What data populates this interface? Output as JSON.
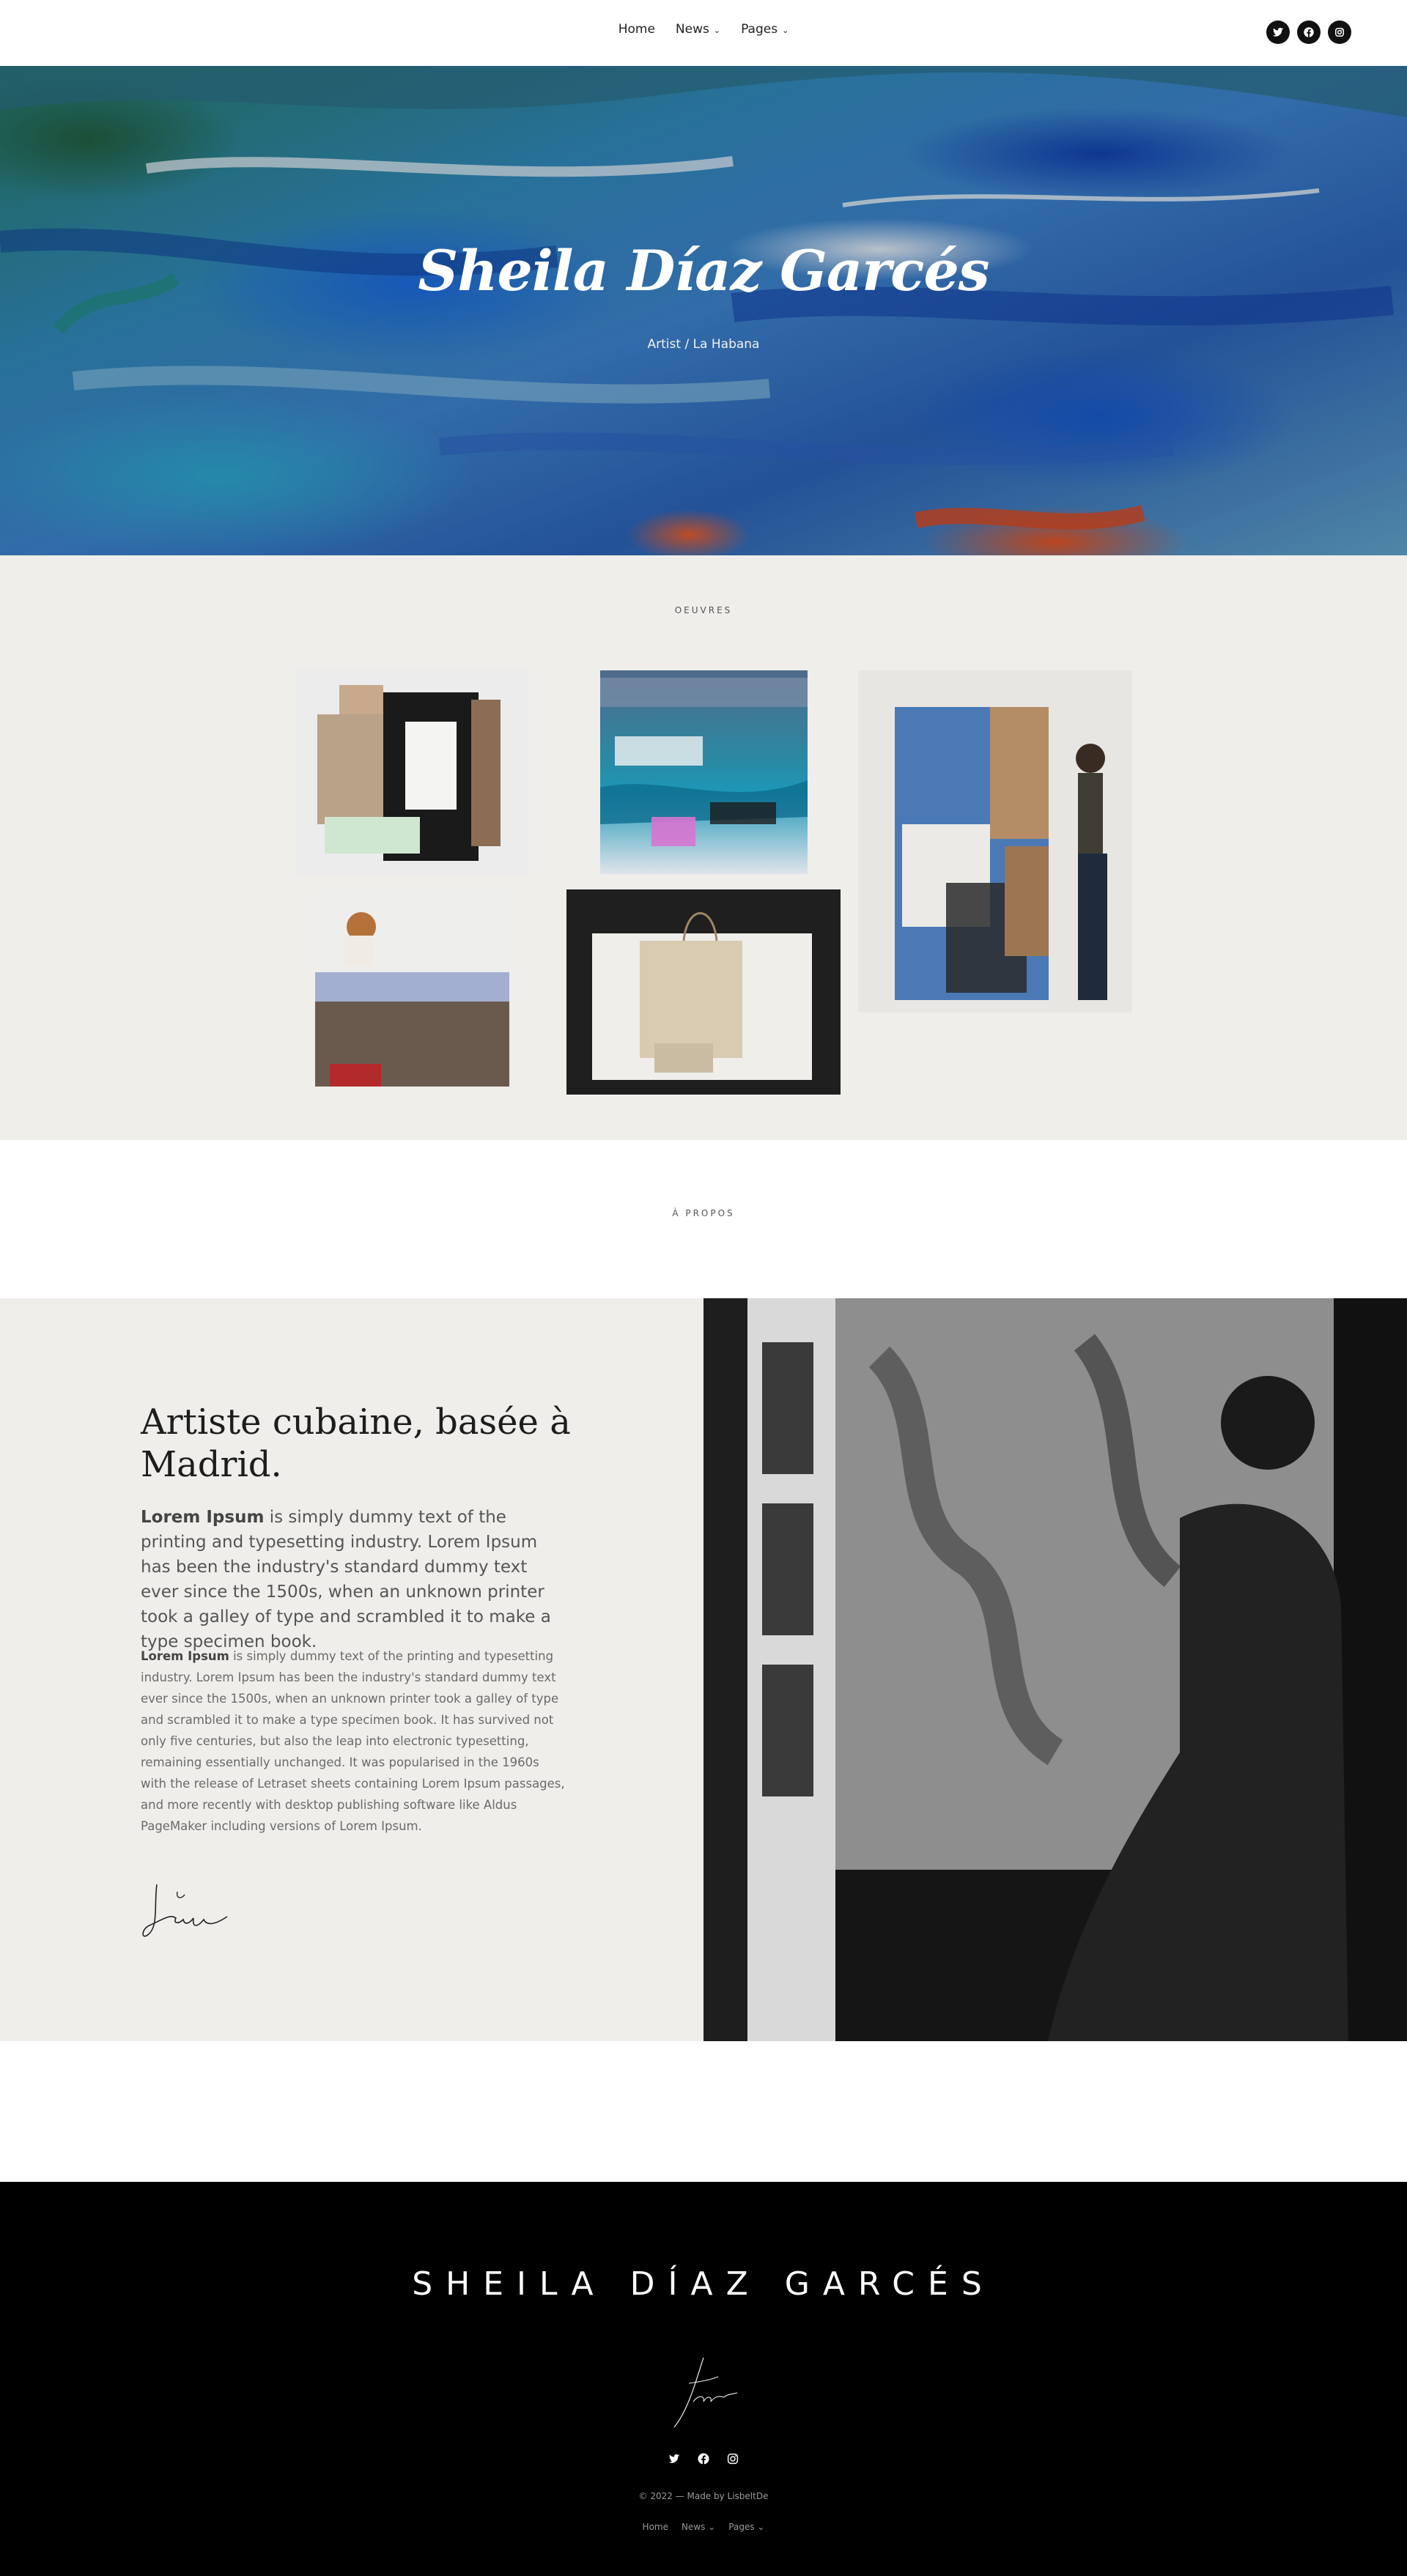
{
  "nav": {
    "items": [
      {
        "label": "Home",
        "has_dropdown": false
      },
      {
        "label": "News",
        "has_dropdown": true
      },
      {
        "label": "Pages",
        "has_dropdown": true
      }
    ],
    "socials": [
      "twitter-icon",
      "facebook-icon",
      "instagram-icon"
    ]
  },
  "hero": {
    "title": "Sheila Díaz Garcés",
    "subtitle": "Artist / La Habana"
  },
  "oeuvres": {
    "label": "OEUVRES"
  },
  "apropos": {
    "label": "À PROPOS",
    "heading": "Artiste cubaine, basée à Madrid.",
    "lead_bold": "Lorem Ipsum",
    "lead_text": " is simply dummy text of the printing and typesetting industry. Lorem Ipsum has been the industry's standard dummy text ever since the 1500s, when an unknown printer took a galley of type and scrambled it to make a type specimen book.",
    "body_bold": "Lorem Ipsum",
    "body_text": " is simply dummy text of the printing and typesetting industry. Lorem Ipsum has been the industry's standard dummy text ever since the 1500s, when an unknown printer took a galley of type and scrambled it to make a type specimen book. It has survived not only five centuries, but also the leap into electronic typesetting, remaining essentially unchanged. It was popularised in the 1960s with the release of Letraset sheets containing Lorem Ipsum passages, and more recently with desktop publishing software like Aldus PageMaker including versions of Lorem Ipsum."
  },
  "footer": {
    "title": "SHEILA DÍAZ GARCÉS",
    "socials": [
      "twitter-icon",
      "facebook-icon",
      "instagram-icon"
    ],
    "copyright": "© 2022 — Made by LisbeltDe",
    "nav": [
      {
        "label": "Home"
      },
      {
        "label": "News ⌄"
      },
      {
        "label": "Pages ⌄"
      }
    ]
  },
  "colors": {
    "page_bg": "#ffffff",
    "section_bg": "#efeeea",
    "footer_bg": "#000000",
    "text": "#222222"
  }
}
